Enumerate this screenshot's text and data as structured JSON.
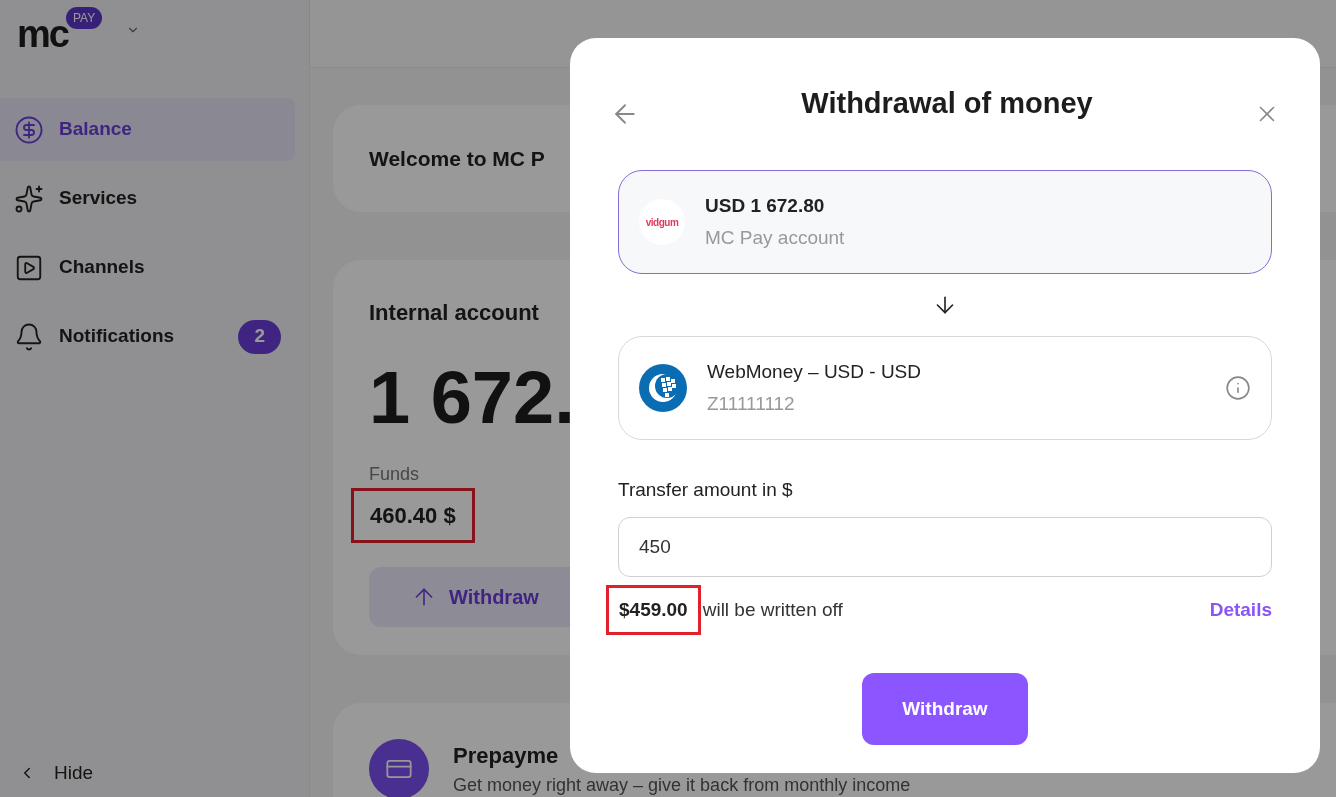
{
  "logo": {
    "text": "mc",
    "badge": "PAY"
  },
  "sidebar": {
    "items": [
      {
        "label": "Balance",
        "selected": true
      },
      {
        "label": "Services",
        "selected": false
      },
      {
        "label": "Channels",
        "selected": false
      },
      {
        "label": "Notifications",
        "selected": false,
        "badge": "2"
      }
    ],
    "hide": "Hide"
  },
  "welcome": {
    "title": "Welcome to MC P"
  },
  "account": {
    "title": "Internal account",
    "amount": "1 672.",
    "funds_label": "Funds",
    "funds_value": "460.40 $",
    "funds_highlighted": true,
    "withdraw": "Withdraw"
  },
  "prepayment": {
    "title": "Prepayme",
    "text": "Get money right away – give it back from monthly income"
  },
  "modal": {
    "title": "Withdrawal of money",
    "source": {
      "logo_text": "vidgum",
      "amount": "USD 1 672.80",
      "subtitle": "MC Pay account",
      "selected": true
    },
    "destination": {
      "name": "WebMoney – USD - USD",
      "number": "Z11111112",
      "selected": false
    },
    "amount_label": "Transfer amount in $",
    "amount_value": "450",
    "written_off": {
      "amount": "$459.00",
      "text": "will be written off",
      "highlighted": true
    },
    "details": "Details",
    "submit": "Withdraw"
  }
}
